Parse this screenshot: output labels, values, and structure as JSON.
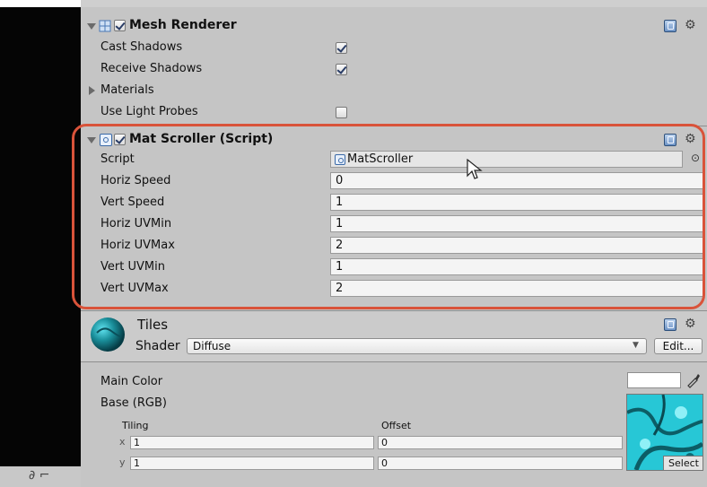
{
  "colors": {
    "highlight": "#d9533a",
    "panel_bg": "#c5c5c5",
    "field_bg": "#f4f4f4",
    "texture": "#2ec4d4"
  },
  "mesh_renderer": {
    "title": "Mesh Renderer",
    "enabled": true,
    "icons": {
      "component": "mesh-renderer-icon",
      "help": "help-book-icon",
      "settings": "gear-icon"
    },
    "props": [
      {
        "label": "Cast Shadows",
        "checked": true
      },
      {
        "label": "Receive Shadows",
        "checked": true
      },
      {
        "label": "Materials",
        "foldout": true
      },
      {
        "label": "Use Light Probes",
        "checked": false
      }
    ]
  },
  "mat_scroller": {
    "title": "Mat Scroller (Script)",
    "enabled": true,
    "script_label": "Script",
    "script_value": "MatScroller",
    "fields": [
      {
        "label": "Horiz Speed",
        "value": "0"
      },
      {
        "label": "Vert Speed",
        "value": "1"
      },
      {
        "label": "Horiz UVMin",
        "value": "1"
      },
      {
        "label": "Horiz UVMax",
        "value": "2"
      },
      {
        "label": "Vert UVMin",
        "value": "1"
      },
      {
        "label": "Vert UVMax",
        "value": "2"
      }
    ]
  },
  "material": {
    "name": "Tiles",
    "shader_label": "Shader",
    "shader_value": "Diffuse",
    "edit_label": "Edit...",
    "main_color_label": "Main Color",
    "base_label": "Base (RGB)",
    "tiling_label": "Tiling",
    "offset_label": "Offset",
    "x_label": "x",
    "y_label": "y",
    "tiling_x": "1",
    "tiling_y": "1",
    "offset_x": "0",
    "offset_y": "0",
    "select_label": "Select"
  }
}
